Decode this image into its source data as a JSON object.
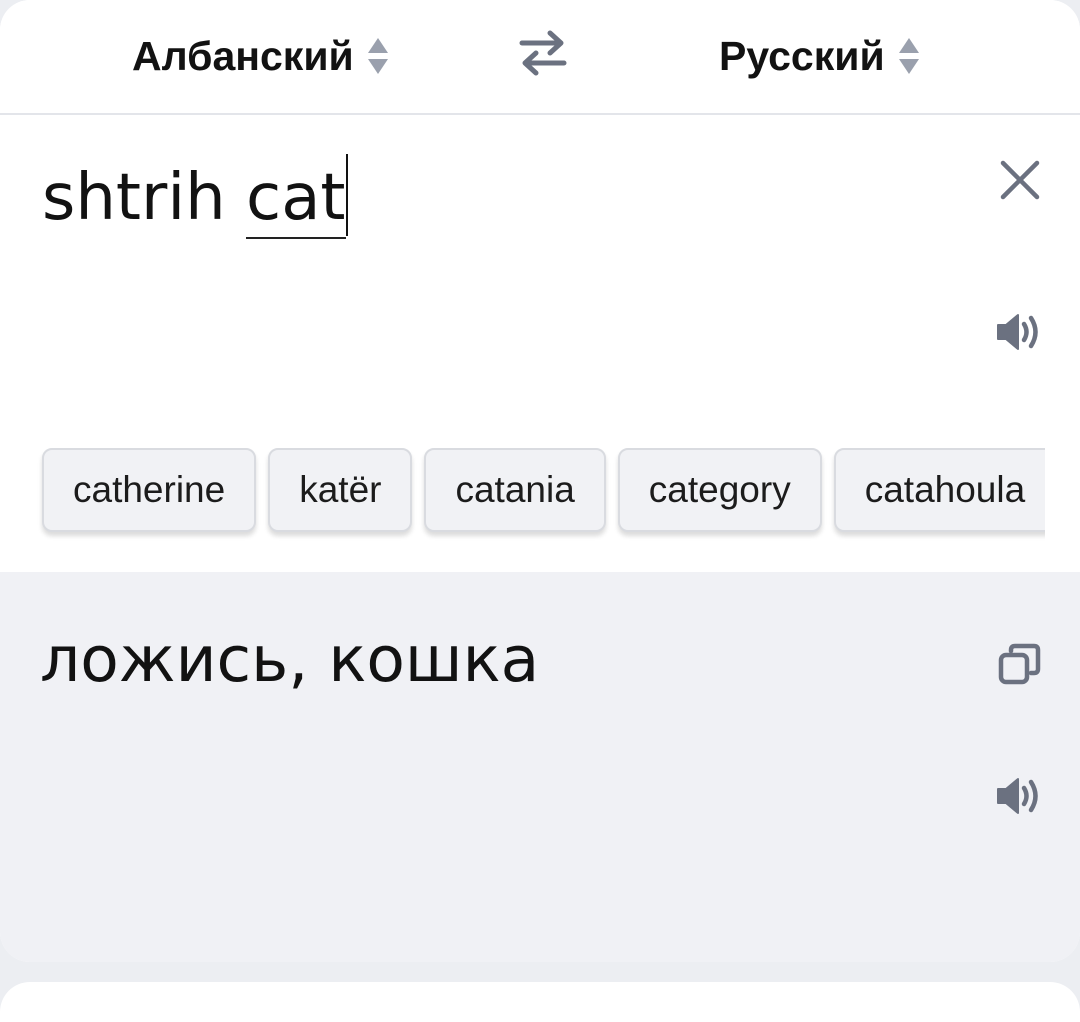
{
  "header": {
    "source_language": "Албанский",
    "target_language": "Русский"
  },
  "input": {
    "text_before": "shtrih ",
    "current_word": "cat"
  },
  "suggestions": [
    "catherine",
    "katër",
    "catania",
    "category",
    "catahoula"
  ],
  "translation": {
    "text": "ложись, кошка"
  },
  "icons": {
    "sort": "sort-arrows-icon",
    "swap": "swap-languages-icon",
    "clear": "close-icon",
    "speaker": "speaker-icon",
    "copy": "copy-icon"
  },
  "colors": {
    "icon": "#6b7180",
    "translation_bg": "#f0f1f5",
    "chip_bg": "#f1f2f5"
  }
}
